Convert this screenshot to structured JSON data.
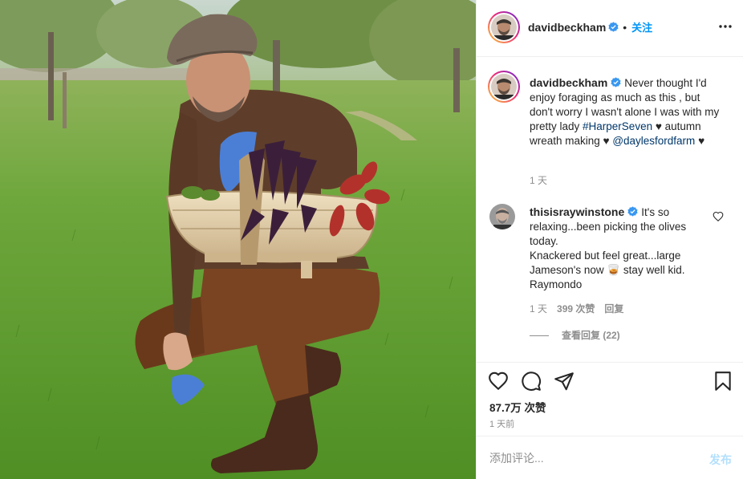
{
  "post": {
    "author": "davidbeckham",
    "follow_label": "关注",
    "caption_parts": {
      "text1": "Never thought I'd enjoy foraging as much as this , but don't worry I wasn't alone I was with my pretty lady ",
      "hashtag": "#HarperSeven",
      "text2": " ♥ autumn wreath making ♥ ",
      "mention": "@daylesfordfarm",
      "text3": " ♥"
    },
    "caption_age": "1 天"
  },
  "comment": {
    "author": "thisisraywinstone",
    "text_line1": "It's so relaxing...been picking the olives today.",
    "text_line2": "Knackered but feel great...large Jameson's now 🥃 stay well kid.",
    "text_line3": "Raymondo",
    "age": "1 天",
    "likes": "399 次赞",
    "reply_label": "回复",
    "view_replies": "查看回复 (22)"
  },
  "actions": {
    "icons": [
      "heart-icon",
      "comment-icon",
      "share-icon",
      "bookmark-icon"
    ],
    "likes_label": "87.7万 次赞",
    "posted": "1 天前"
  },
  "composer": {
    "placeholder": "添加评论...",
    "post_label": "发布"
  },
  "colors": {
    "link": "#00376b",
    "accent": "#0095f6",
    "verified": "#3897f0",
    "muted": "#8e8e8e",
    "post_disabled": "#b2dffc"
  }
}
